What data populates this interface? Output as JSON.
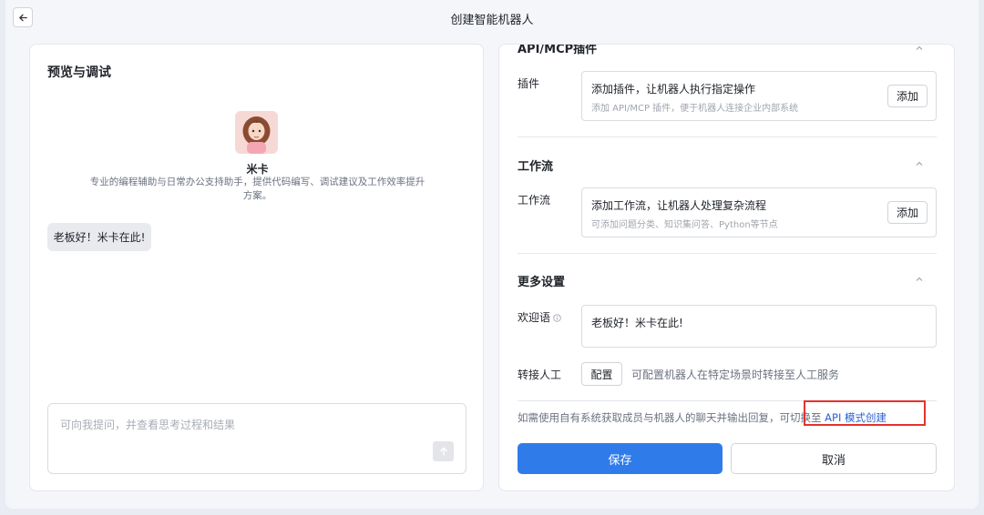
{
  "header": {
    "title": "创建智能机器人"
  },
  "preview": {
    "title": "预览与调试",
    "bot_name": "米卡",
    "bot_desc": "专业的编程辅助与日常办公支持助手，提供代码编写、调试建议及工作效率提升方案。",
    "greeting_bubble": "老板好！米卡在此!",
    "input_placeholder": "可向我提问，并查看思考过程和结果"
  },
  "config": {
    "api_section_title": "API/MCP插件",
    "plugin": {
      "label": "插件",
      "main": "添加插件，让机器人执行指定操作",
      "sub": "添加 API/MCP 插件，便于机器人连接企业内部系统",
      "button": "添加"
    },
    "workflow_section_title": "工作流",
    "workflow": {
      "label": "工作流",
      "main": "添加工作流，让机器人处理复杂流程",
      "sub": "可添加问题分类、知识集问答、Python等节点",
      "button": "添加"
    },
    "more_section_title": "更多设置",
    "welcome": {
      "label": "欢迎语",
      "value": "老板好！米卡在此!"
    },
    "transfer": {
      "label": "转接人工",
      "button": "配置",
      "desc": "可配置机器人在特定场景时转接至人工服务"
    },
    "note_text": "如需使用自有系统获取成员与机器人的聊天并输出回复，可切换至 ",
    "note_link": "API 模式创建",
    "save_label": "保存",
    "cancel_label": "取消"
  },
  "colors": {
    "primary": "#2f7bea",
    "link": "#2a62d3",
    "highlight": "#e5322d"
  }
}
